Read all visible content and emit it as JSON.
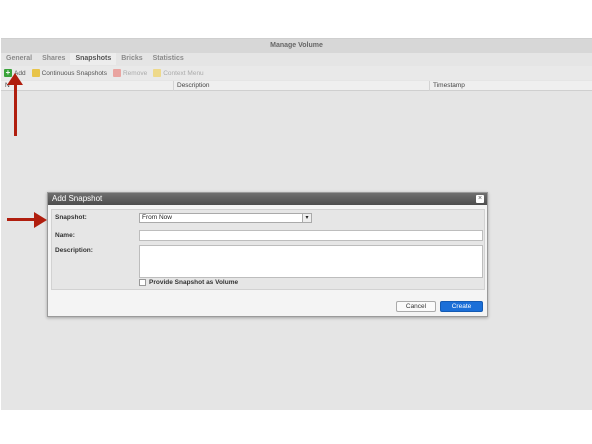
{
  "window": {
    "title": "Manage Volume"
  },
  "tabs": [
    {
      "label": "General"
    },
    {
      "label": "Shares"
    },
    {
      "label": "Snapshots"
    },
    {
      "label": "Bricks"
    },
    {
      "label": "Statistics"
    }
  ],
  "active_tab": "Snapshots",
  "toolbar": {
    "add": "Add",
    "continuous": "Continuous Snapshots",
    "remove": "Remove",
    "context": "Context Menu"
  },
  "grid": {
    "columns": [
      "N",
      "Description",
      "Timestamp"
    ]
  },
  "dialog": {
    "title": "Add Snapshot",
    "close_glyph": "×",
    "snapshot_label": "Snapshot:",
    "snapshot_value": "From Now",
    "name_label": "Name:",
    "description_label": "Description:",
    "provide_label": "Provide Snapshot as Volume",
    "cancel": "Cancel",
    "create": "Create"
  },
  "colors": {
    "annotation_arrow": "#b01e0e",
    "primary_button": "#1b6fd8"
  }
}
